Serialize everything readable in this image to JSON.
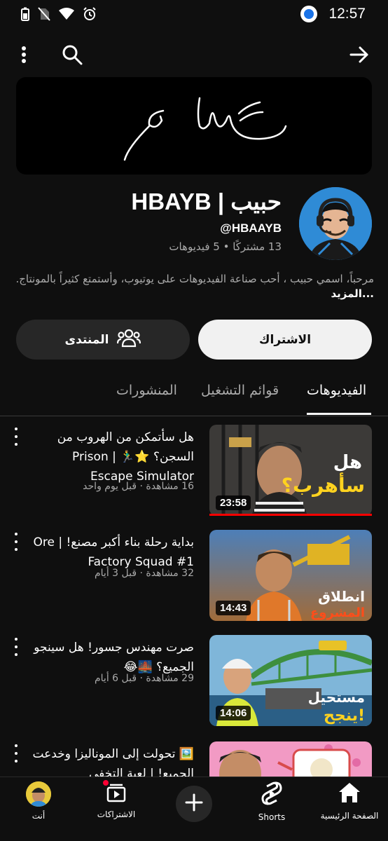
{
  "status_bar": {
    "time": "12:57",
    "left_icons": [
      "battery-icon",
      "no-sim-icon",
      "wifi-icon",
      "alarm-icon"
    ],
    "right_icons": [
      "app-notification-icon"
    ]
  },
  "top_bar": {
    "icons": [
      "more-vert-icon",
      "search-icon",
      "forward-arrow-icon"
    ]
  },
  "banner": {
    "handwriting": "سك م"
  },
  "channel": {
    "name": "حبيب | HBAYB",
    "handle": "@HBAAYB",
    "stats": "13 مشتركًا • 5 فيديوهات",
    "description": "مرحباً، اسمي حبيب ، أحب صناعة الفيديوهات على يوتيوب، وأستمتع كثيراً بالمونتاج.",
    "more_label": "...المزيد"
  },
  "buttons": {
    "subscribe_label": "الاشتراك",
    "forum_label": "المنتدى"
  },
  "tabs": [
    {
      "label": "الفيديوهات",
      "active": true
    },
    {
      "label": "قوائم التشغيل",
      "active": false
    },
    {
      "label": "المنشورات",
      "active": false
    }
  ],
  "videos": [
    {
      "title": "هل سأتمكن من الهروب من السجن؟ ⭐🏃‍♂️ | Prison Escape Simulator",
      "meta": "16 مشاهدة · قبل يوم واحد",
      "duration": "23:58",
      "thumb_text": "هل سأهرب؟",
      "progress": 1.0
    },
    {
      "title": "بداية رحلة بناء أكبر مصنع! | Ore Factory Squad #1",
      "meta": "32 مشاهدة · قبل 3 أيام",
      "duration": "14:43",
      "thumb_text": "انطلاق المشروع",
      "progress": 0
    },
    {
      "title": "صرت مهندس جسور! هل سينجو الجميع؟ 🌉😂",
      "meta": "29 مشاهدة · قبل 6 أيام",
      "duration": "14:06",
      "thumb_text": "مستحيل ينجح!",
      "progress": 0
    },
    {
      "title": "🖼️ تحولت إلى الموناليزا وخدعت الجميع! | لعبة التخفي",
      "meta": "",
      "duration": "",
      "thumb_text": "",
      "progress": 0
    }
  ],
  "bottom_nav": [
    {
      "label": "الصفحة الرئيسية",
      "icon": "home-icon"
    },
    {
      "label": "Shorts",
      "icon": "shorts-icon"
    },
    {
      "label": "",
      "icon": "create-plus-icon"
    },
    {
      "label": "الاشتراكات",
      "icon": "subscriptions-icon"
    },
    {
      "label": "أنت",
      "icon": "avatar-icon"
    }
  ],
  "colors": {
    "background": "#0f0f0f",
    "accent_red": "#ff0000",
    "avatar_blue": "#2f8bd6",
    "text_secondary": "#aaaaaa"
  }
}
